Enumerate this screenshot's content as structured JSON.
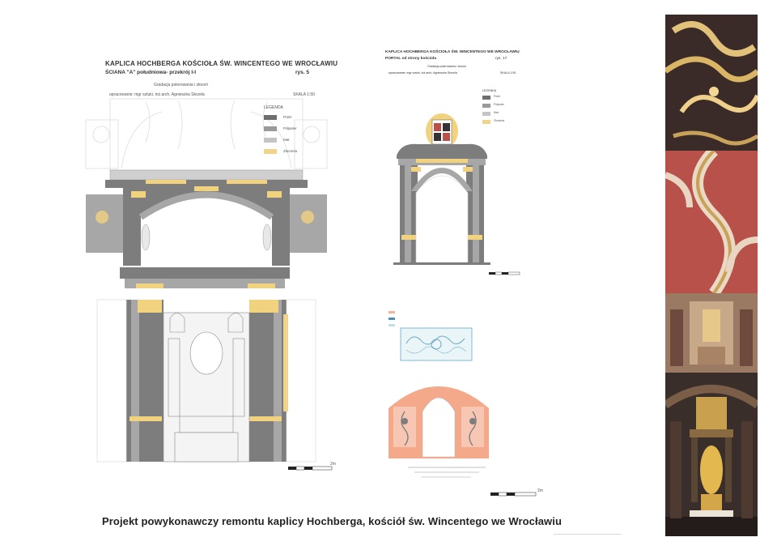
{
  "drawing_a": {
    "title": "KAPLICA HOCHBERGA KOŚCIOŁA ŚW. WINCENTEGO WE WROCŁAWIU",
    "subtitle": "ŚCIANA \"A\" południowa- przekrój I-I",
    "sheet_no": "rys. 5",
    "topic": "Gradacja polerowania i złoceń",
    "author_line": "opracowanie:  mgr sztuki, inż.arch. Agnieszka Skrzela",
    "scale": "SKALA 1:50",
    "legend_title": "LEGENDA",
    "legend": [
      {
        "label": "Poler",
        "color": "#6e6e6e"
      },
      {
        "label": "Półpoler",
        "color": "#9a9a9a"
      },
      {
        "label": "Mat",
        "color": "#c4c4c4"
      },
      {
        "label": "Złocenia",
        "color": "#f0d48a"
      }
    ],
    "scalebar_label": "2m"
  },
  "drawing_b": {
    "title": "KAPLICA HOCHBERGA KOŚCIOŁA ŚW. WINCENTEGO WE WROCŁAWIU",
    "subtitle": "PORTAL od strony kościoła",
    "sheet_no": "rys. 17",
    "topic": "Gradacja polerowania i złoceń",
    "author_line": "opracowanie:  mgr sztuki, inż.arch. Agnieszka Skrzela",
    "scale": "SKALA 1:50",
    "legend_title": "LEGENDA",
    "legend": [
      {
        "label": "Poler",
        "color": "#6e6e6e"
      },
      {
        "label": "Półpoler",
        "color": "#9a9a9a"
      },
      {
        "label": "Mat",
        "color": "#c4c4c4"
      },
      {
        "label": "Złocenia",
        "color": "#f0d48a"
      }
    ]
  },
  "drawing_c": {
    "legend": [
      {
        "label": "",
        "color": "#f3b49a"
      },
      {
        "label": "",
        "color": "#4f8fb8"
      },
      {
        "label": "",
        "color": "#bfe0ea"
      }
    ],
    "scalebar_label": "2m"
  },
  "caption": "Projekt powykonawczy remontu kaplicy Hochberga, kościół św. Wincentego we Wrocławiu",
  "colors": {
    "grey_dark": "#7d7d7d",
    "grey_mid": "#a7a7a7",
    "grey_light": "#cfcfcf",
    "gold": "#f1d27f",
    "salmon": "#f4a98a",
    "stucco_red": "#b8514a",
    "marble_dark": "#3a2a28"
  }
}
